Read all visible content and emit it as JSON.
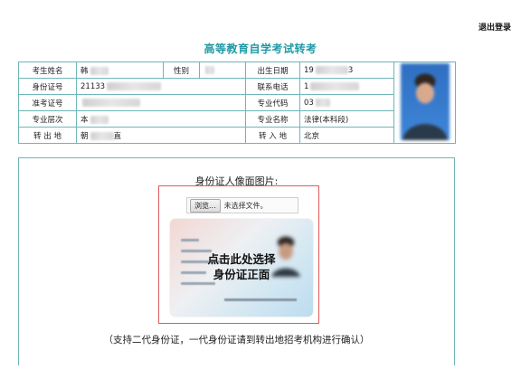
{
  "header": {
    "logout_label": "退出登录"
  },
  "page": {
    "title": "高等教育自学考试转考"
  },
  "info": {
    "name_label": "考生姓名",
    "name_value": "韩",
    "gender_label": "性别",
    "gender_value": "",
    "birth_label": "出生日期",
    "birth_value_start": "19",
    "birth_value_end": "3",
    "id_label": "身份证号",
    "id_value": "21133",
    "phone_label": "联系电话",
    "phone_value": "1",
    "exam_label": "准考证号",
    "exam_value": "",
    "major_code_label": "专业代码",
    "major_code_value": "03",
    "level_label": "专业层次",
    "level_value": "本",
    "major_name_label": "专业名称",
    "major_name_value": "法律(本科段)",
    "from_label": "转 出 地",
    "from_value_start": "朝",
    "from_value_end": "直",
    "to_label": "转 入 地",
    "to_value": "北京"
  },
  "upload": {
    "label": "身份证人像面图片:",
    "browse_label": "浏览...",
    "no_file_label": "未选择文件。",
    "overlay_line1": "点击此处选择",
    "overlay_line2": "身份证正面",
    "note": "（支持二代身份证，一代身份证请到转出地招考机构进行确认）"
  }
}
